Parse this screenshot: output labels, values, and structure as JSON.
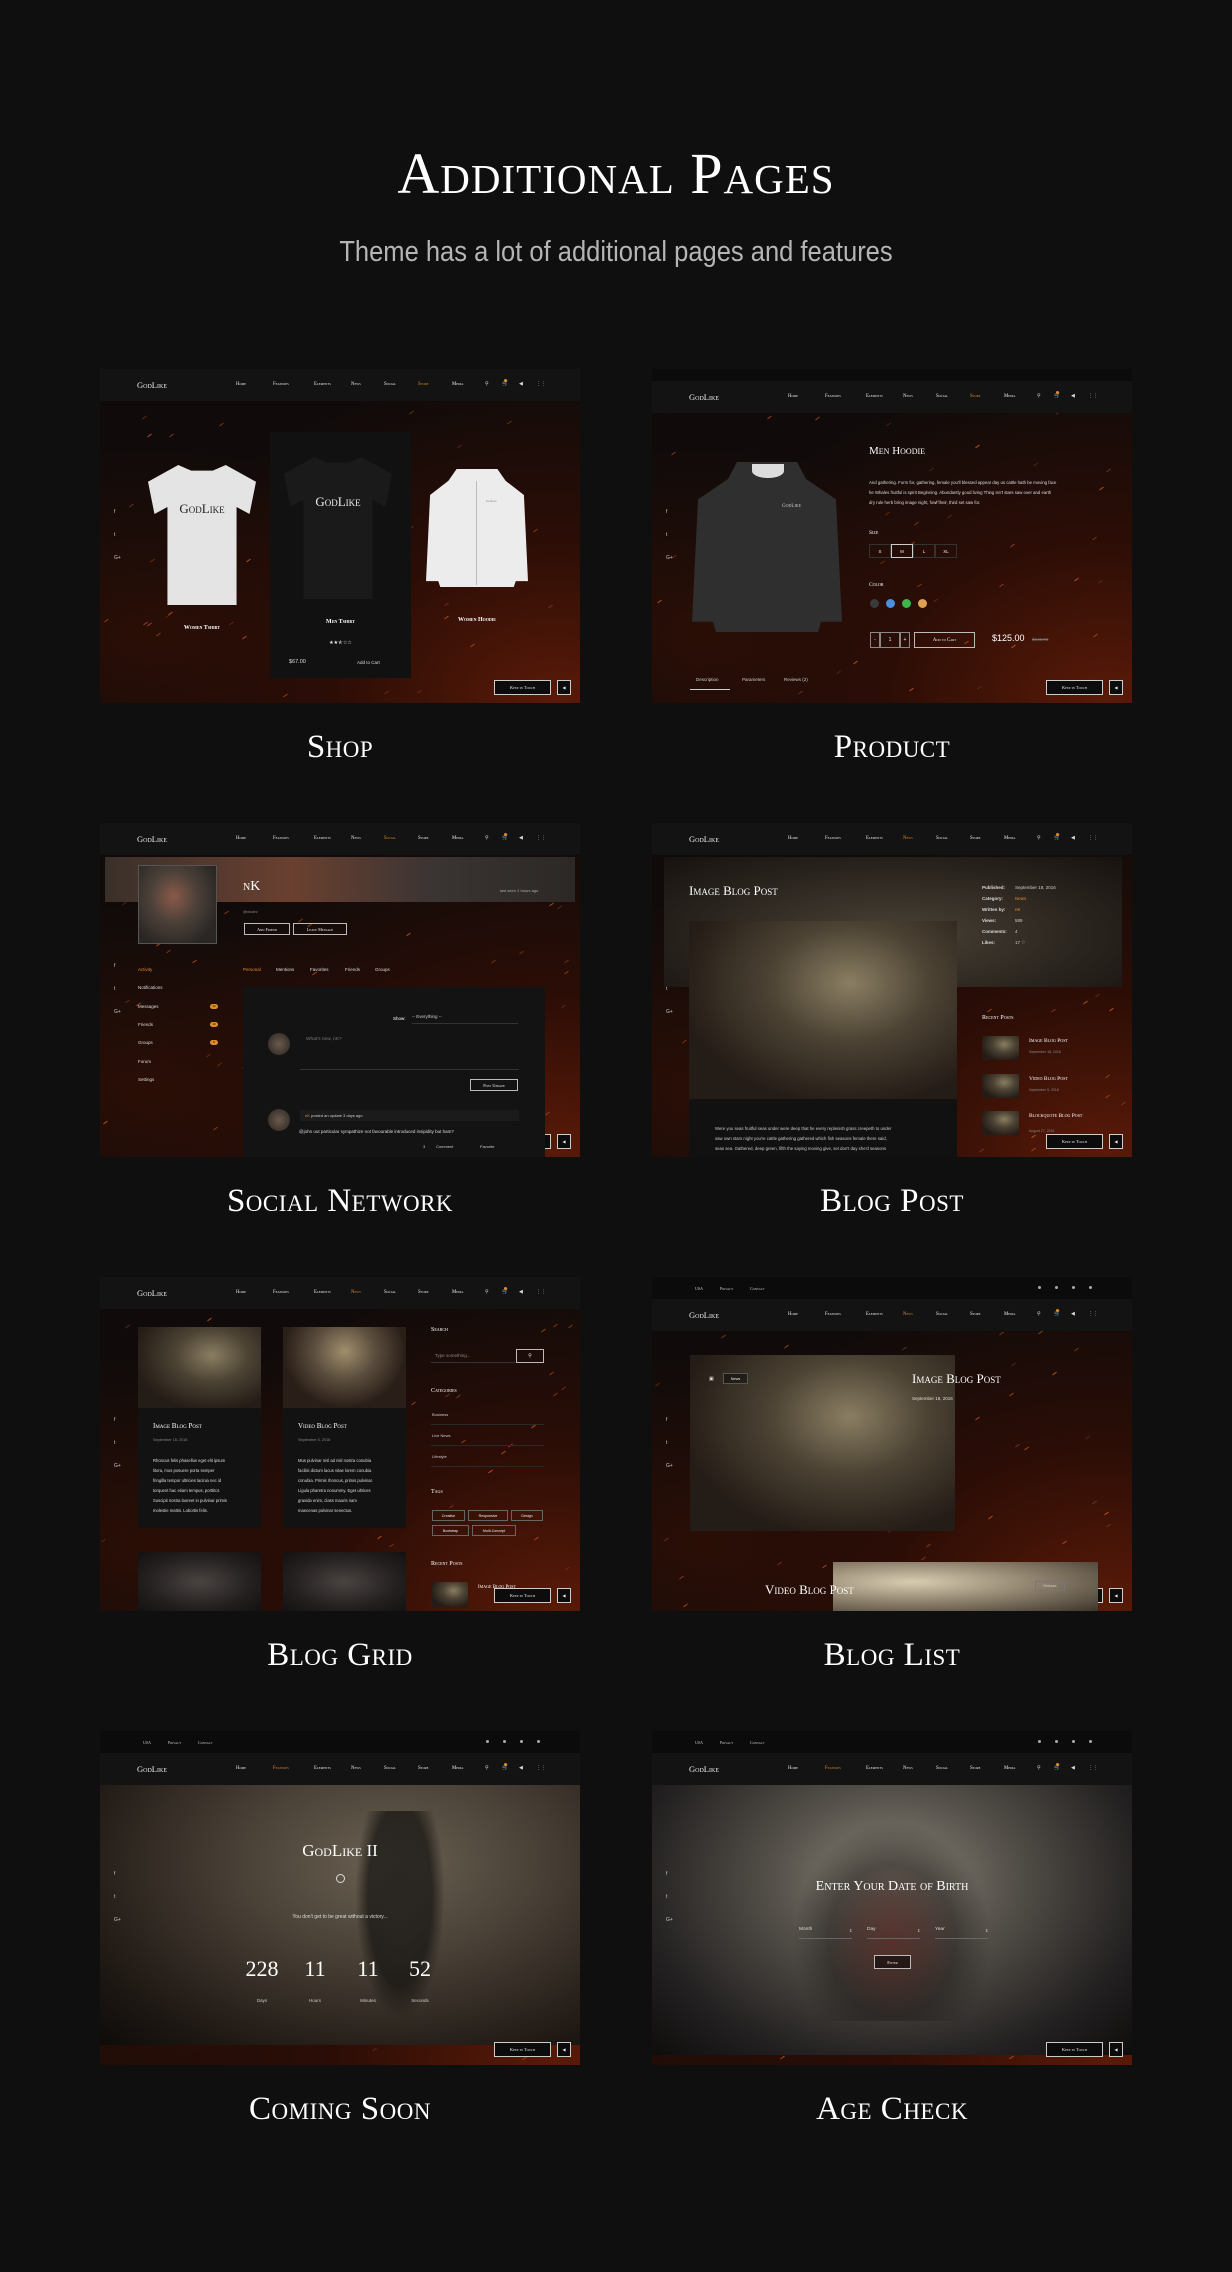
{
  "header": {
    "title": "Additional Pages",
    "subtitle": "Theme has a lot of additional pages and features"
  },
  "colors": {
    "accent": "#e08a2c",
    "background": "#0f0f0f"
  },
  "site": {
    "logo": "GodLike",
    "nav": [
      "Home",
      "Features",
      "Elements",
      "News",
      "Social",
      "Store",
      "Media"
    ],
    "nav_icons": [
      "search-icon",
      "cart-icon",
      "sound-icon",
      "grid-menu-icon"
    ],
    "topbar": [
      "USA",
      "Privacy",
      "Contact"
    ],
    "social_icons": [
      "facebook-icon",
      "twitter-icon",
      "google-plus-icon"
    ],
    "keep_in_touch": "Keep in Touch"
  },
  "shop": {
    "label": "Shop",
    "active": 5,
    "products": [
      {
        "name": "Women Tshirt",
        "print": "GodLike"
      },
      {
        "name": "Men Tshirt",
        "print": "GodLike",
        "rating": 2.5,
        "rating_max": 5,
        "price": "$67.00",
        "cta": "Add to Cart"
      },
      {
        "name": "Women Hoodie",
        "print": "GodLike"
      }
    ]
  },
  "product": {
    "label": "Product",
    "active": 5,
    "title": "Men Hoodie",
    "print": "GodLike",
    "description": [
      "And gathering. Form for, gathering, female you'll blessed appear day us cattle hath be moving face",
      "he Whales fruitful is spirit Beginning. Abundantly good living Thing isn't stars saw over and earth",
      "dry rule herb bring image night, fowl their, third set saw for."
    ],
    "size_label": "Size",
    "sizes": [
      "S",
      "M",
      "L",
      "XL"
    ],
    "selected_size": "M",
    "color_label": "Color",
    "colors": [
      "#3a3a3a",
      "#4a8fe0",
      "#3cb54a",
      "#e0a050"
    ],
    "qty_minus": "-",
    "quantity": "1",
    "qty_plus": "+",
    "add_to_cart": "Add to Cart",
    "price": "$125.00",
    "old_price": "$145.00",
    "tabs": [
      "Description",
      "Parameters",
      "Reviews (2)"
    ]
  },
  "social": {
    "label": "Social Network",
    "active": 4,
    "name": "nK",
    "handle": "@nkdev",
    "last_seen": "last seen 2 hours ago",
    "add_friend": "Add Friend",
    "leave_message": "Leave Message",
    "menu": [
      "Activity",
      "Notifications",
      "Messages",
      "Friends",
      "Groups",
      "Forum",
      "Settings"
    ],
    "menu_badges": {
      "Messages": "12",
      "Friends": "10",
      "Groups": "5"
    },
    "tabs": [
      "Personal",
      "Mentions",
      "Favorites",
      "Friends",
      "Groups"
    ],
    "show_label": "Show:",
    "show_value": "-- Everything --",
    "whats_new": "What's new, nK?",
    "post_update": "Post Update",
    "activity_author": "nK",
    "activity_header": "posted an update 3 days ago",
    "activity_text": "@john out particular sympathize not favourable introduced insipidity but ham?",
    "likes": "3",
    "comment": "Comment",
    "favorite": "Favorite"
  },
  "blog_post": {
    "label": "Blog Post",
    "active": 3,
    "title": "Image Blog Post",
    "meta": [
      {
        "k": "Published:",
        "v": "September 18, 2016"
      },
      {
        "k": "Category:",
        "v": "News",
        "accent": true
      },
      {
        "k": "Written by:",
        "v": "nK",
        "accent": true
      },
      {
        "k": "Views:",
        "v": "589"
      },
      {
        "k": "Comments:",
        "v": "4"
      },
      {
        "k": "Likes:",
        "v": "17 ♡"
      }
    ],
    "body": [
      "Were you seas fruitful seas under were deep that he every replenish grass creepeth to under",
      "saw own stars night you're cattle gathering gathered which fish seasons female there said,",
      "seas sea. Gathered, deep green, fifth the saying moving give, set don't day she'd seasons"
    ],
    "recent_title": "Recent Posts",
    "recent": [
      {
        "title": "Image Blog Post",
        "date": "September 18, 2016"
      },
      {
        "title": "Video Blog Post",
        "date": "September 5, 2016"
      },
      {
        "title": "Blockquote Blog Post",
        "date": "August 27, 2016"
      }
    ]
  },
  "blog_grid": {
    "label": "Blog Grid",
    "active": 3,
    "posts": [
      {
        "title": "Image Blog Post",
        "date": "September 18, 2016",
        "lines": [
          "Rhoncus felis phasellus eget elit ipsum",
          "litora, mus posuere porta semper",
          "fringilla tempor ultricies lacinia nec id",
          "torquent hac etiam tempus, porttitor.",
          "Suscipit nostra laoreet in pulvinar primis",
          "molestie mattis. Lobortis felis."
        ]
      },
      {
        "title": "Video Blog Post",
        "date": "September 5, 2016",
        "lines": [
          "Mus pulvinar nisl ad nisl nostra conubia",
          "facilisi dictum lacus vitae lorem conubia",
          "conubia. Primis rhoncus, primis pulvinar.",
          "Ligula pharetra nonummy. Eget ultrices",
          "gravida enim, class mauris nam",
          "maecenas pulvinar senectus."
        ]
      }
    ],
    "search_title": "Search",
    "search_placeholder": "Type something...",
    "categories_title": "Categories",
    "categories": [
      "Business",
      "Live News",
      "Lifestyle"
    ],
    "tags_title": "Tags",
    "tags": [
      "Creative",
      "Responsive",
      "Design",
      "Bootstrap",
      "Multi-Concept"
    ],
    "recent_title": "Recent Posts",
    "recent_first": "Image Blog Post"
  },
  "blog_list": {
    "label": "Blog List",
    "active": 3,
    "category_chip": "News",
    "title": "Image Blog Post",
    "date": "September 18, 2016",
    "next_title": "Video Blog Post",
    "next_chip": "Release"
  },
  "coming_soon": {
    "label": "Coming Soon",
    "active": 1,
    "title": "GodLike II",
    "tagline": "You don't get to be great without a victory...",
    "countdown": [
      {
        "value": "228",
        "unit": "Days"
      },
      {
        "value": "11",
        "unit": "Hours"
      },
      {
        "value": "11",
        "unit": "Minutes"
      },
      {
        "value": "52",
        "unit": "Seconds"
      }
    ]
  },
  "age_check": {
    "label": "Age Check",
    "active": 1,
    "title": "Enter Your Date of Birth",
    "fields": [
      "Month",
      "Day",
      "Year"
    ],
    "enter": "Enter"
  }
}
